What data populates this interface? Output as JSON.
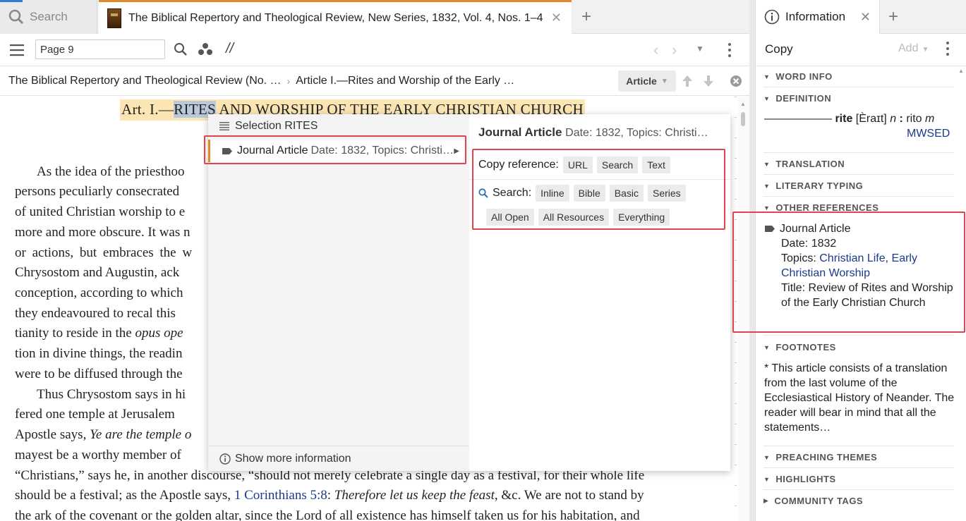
{
  "left_tabs": {
    "search_label": "Search",
    "doc_title": "The Biblical Repertory and Theological Review, New Series, 1832, Vol. 4, Nos. 1–4",
    "close": "✕",
    "add": "+"
  },
  "toolbar": {
    "page_value": "Page 9",
    "parallel_label": "//"
  },
  "breadcrumb": {
    "item1": "The Biblical Repertory and Theological Review (No. …",
    "sep": "›",
    "item2": "Article I.—Rites and Worship of the Early …",
    "article_button": "Article"
  },
  "reader": {
    "title_prefix": "Art. I.—",
    "title_highlight": "RITES",
    "title_rest": " AND WORSHIP OF THE EARLY CHRISTIAN CHURCH",
    "lines": [
      {
        "text": "As the idea of the priesthoo"
      },
      {
        "text": "persons peculiarly consecrated "
      },
      {
        "text": "of united Christian worship to e"
      },
      {
        "text": "more and more obscure. It was n"
      },
      {
        "text": "or actions, but embraces the w"
      },
      {
        "text": "Chrysostom and Augustin, ack"
      },
      {
        "text": "conception, according to which"
      },
      {
        "text": "they endeavoured to recal this"
      },
      {
        "text": "tianity to reside in the "
      },
      {
        "text": "tion in divine things, the readin"
      },
      {
        "text": "were to be diffused through the"
      },
      {
        "text": "Thus Chrysostom says in hi"
      },
      {
        "text": "fered one temple at Jerusalem "
      },
      {
        "text": "Apostle says, "
      },
      {
        "text": "mayest be a worthy member of"
      },
      {
        "text": "“Christians,” says he, in another discourse, “should not merely celebrate a single day as a festival, for their whole life"
      },
      {
        "text": "should be a festival; as the Apostle says, "
      },
      {
        "text": "the ark of the covenant or the golden altar, since the Lord of all existence has himself taken us for his habitation, and"
      }
    ],
    "opus_italic": "opus ope",
    "apostle_italic": "Ye are the temple o",
    "ref_link": "1 Corinthians 5:8",
    "ref_colon": ": ",
    "ref_italic": "Therefore let us keep the feast",
    "ref_end": ", &c. We are not to stand by"
  },
  "popup": {
    "selection_prefix": "Selection",
    "selection_word": "RITES",
    "ja_label": "Journal Article",
    "ja_meta": "Date: 1832, Topics: Christi…",
    "show_more": "Show more information",
    "right_title": "Journal Article",
    "right_meta": "Date: 1832, Topics: Christi…",
    "copy_reference_label": "Copy reference:",
    "copy_chips": [
      "URL",
      "Search",
      "Text"
    ],
    "search_label": "Search:",
    "search_chips": [
      "Inline",
      "Bible",
      "Basic",
      "Series"
    ],
    "search_chips2": [
      "All Open",
      "All Resources",
      "Everything"
    ]
  },
  "right_panel": {
    "tab_label": "Information",
    "close": "✕",
    "add": "+",
    "copy": "Copy",
    "add_menu": "Add",
    "sections": {
      "word_info": "WORD INFO",
      "definition": "DEFINITION",
      "translation": "TRANSLATION",
      "literary_typing": "LITERARY TYPING",
      "other_references": "OTHER REFERENCES",
      "footnotes": "FOOTNOTES",
      "preaching_themes": "PREACHING THEMES",
      "highlights": "HIGHLIGHTS",
      "community_tags": "COMMUNITY TAGS"
    },
    "definition": {
      "dashes": "—————— ",
      "word": "rite",
      "pron": " [Èraɪt] ",
      "pos": "n",
      "sep": " : ",
      "trans": "rito ",
      "gender": "m",
      "source": "MWSED"
    },
    "other_ref": {
      "type": "Journal Article",
      "date_label": "Date: ",
      "date": "1832",
      "topics_label": "Topics: ",
      "topic1": "Christian Life",
      "topic_sep": ", ",
      "topic2": "Early Christian Worship",
      "title_label": "Title: ",
      "title": "Review of Rites and Worship of the Early Christian Church"
    },
    "footnote": "* This article consists of a translation from the last volume of the Ecclesiastical History of Neander. The reader will bear in mind that all the statements…"
  }
}
